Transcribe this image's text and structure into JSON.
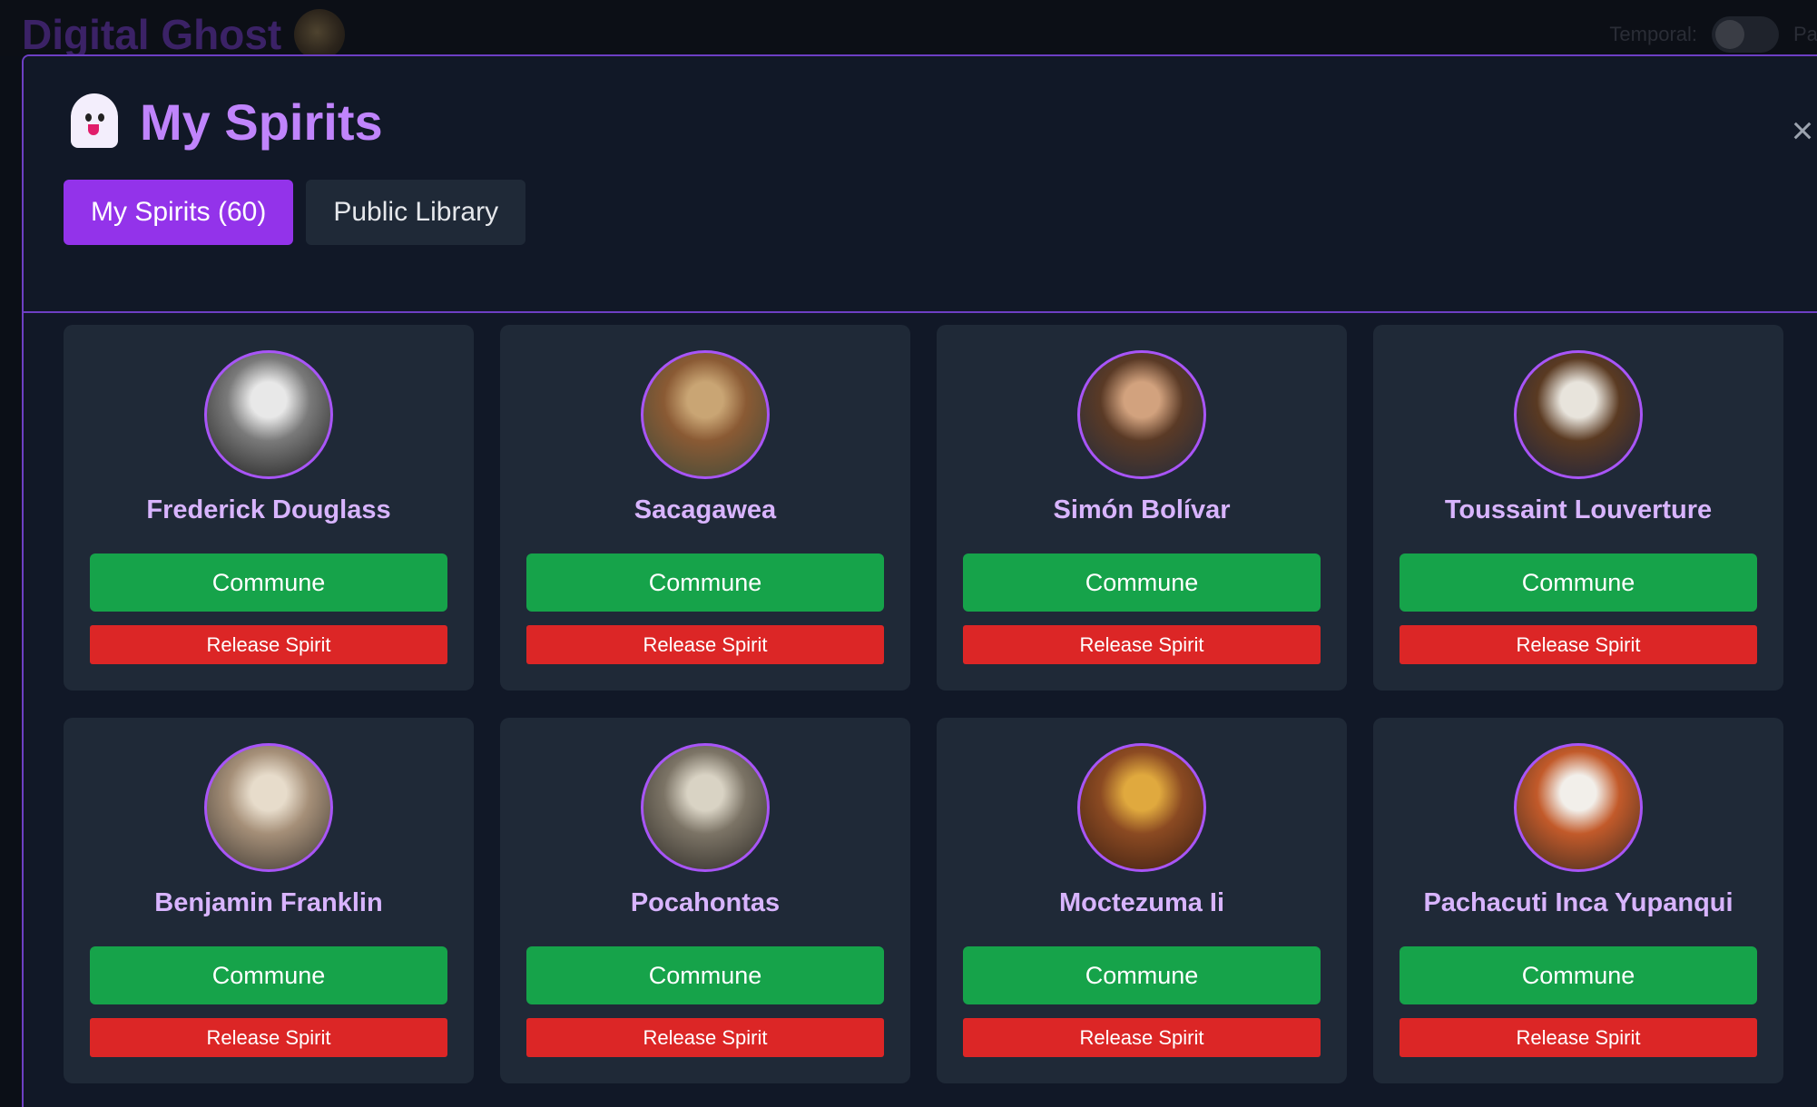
{
  "app": {
    "title": "Digital Ghost",
    "temporal_label": "Temporal:",
    "temporal_trailing": "Pa"
  },
  "modal": {
    "title": "My Spirits",
    "close_symbol": "×",
    "tabs": [
      {
        "label": "My Spirits (60)",
        "active": true
      },
      {
        "label": "Public Library",
        "active": false
      }
    ]
  },
  "spirits": [
    {
      "name": "Frederick Douglass",
      "commune_label": "Commune",
      "release_label": "Release Spirit",
      "portrait_colors": [
        "#e8e8e8",
        "#7a7a7a",
        "#1a1a1a"
      ]
    },
    {
      "name": "Sacagawea",
      "commune_label": "Commune",
      "release_label": "Release Spirit",
      "portrait_colors": [
        "#c9a574",
        "#8a5a34",
        "#3d4a3a"
      ]
    },
    {
      "name": "Simón Bolívar",
      "commune_label": "Commune",
      "release_label": "Release Spirit",
      "portrait_colors": [
        "#d2a27e",
        "#5a3a26",
        "#1f2a3d"
      ]
    },
    {
      "name": "Toussaint Louverture",
      "commune_label": "Commune",
      "release_label": "Release Spirit",
      "portrait_colors": [
        "#e8e4dc",
        "#5a3a22",
        "#1b2340"
      ]
    },
    {
      "name": "Benjamin Franklin",
      "commune_label": "Commune",
      "release_label": "Release Spirit",
      "portrait_colors": [
        "#e7dccb",
        "#a58f78",
        "#3a3530"
      ]
    },
    {
      "name": "Pocahontas",
      "commune_label": "Commune",
      "release_label": "Release Spirit",
      "portrait_colors": [
        "#d9d3c4",
        "#7c7466",
        "#2b2824"
      ]
    },
    {
      "name": "Moctezuma Ii",
      "commune_label": "Commune",
      "release_label": "Release Spirit",
      "portrait_colors": [
        "#e0a93e",
        "#8b4a22",
        "#3a1e12"
      ]
    },
    {
      "name": "Pachacuti Inca Yupanqui",
      "commune_label": "Commune",
      "release_label": "Release Spirit",
      "portrait_colors": [
        "#f2efea",
        "#c25a2a",
        "#3a2a20"
      ]
    }
  ],
  "icons": {
    "logo": "app-logo-icon",
    "ghost": "ghost-icon",
    "close": "close-icon"
  },
  "colors": {
    "accent": "#9333ea",
    "name_text": "#d8b4fe",
    "commune": "#16a34a",
    "release": "#dc2626",
    "card_bg": "#1f2937",
    "modal_bg": "#111827"
  }
}
